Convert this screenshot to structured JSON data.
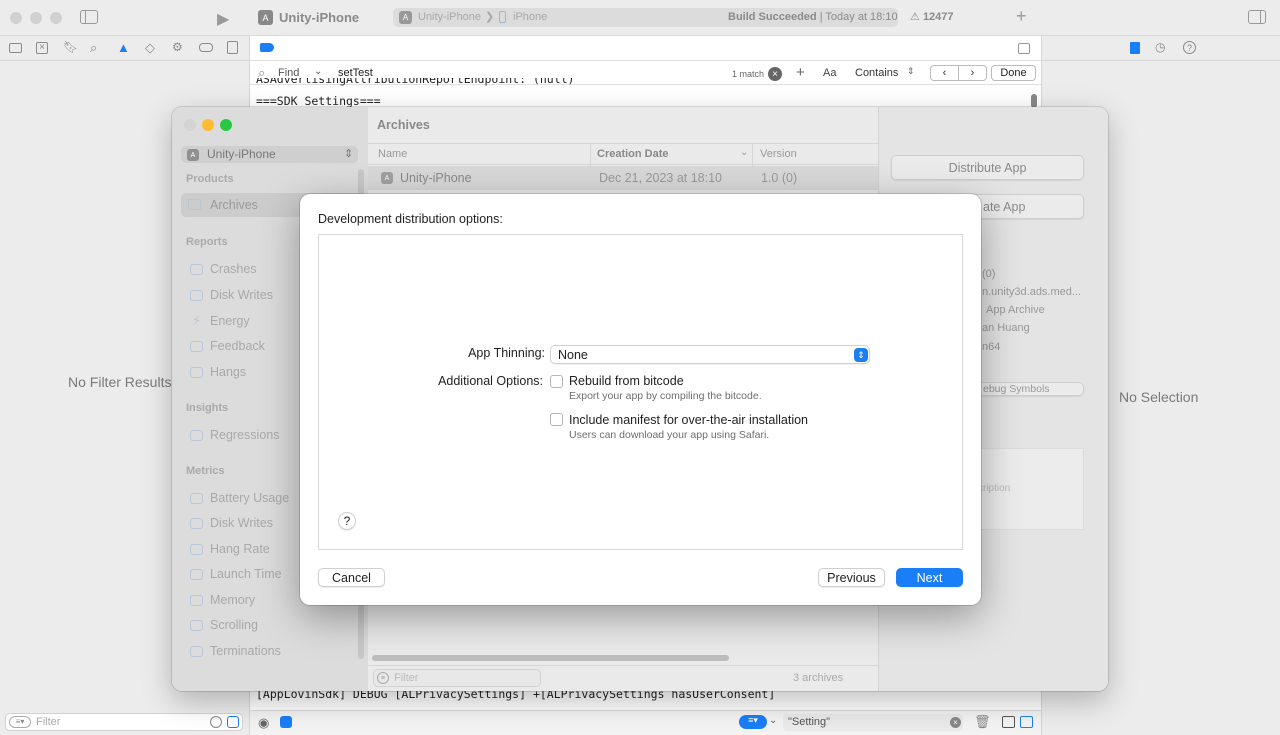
{
  "toolbar": {
    "project": "Unity-iPhone",
    "scheme": "Unity-iPhone",
    "device": "iPhone",
    "status_bold": "Build Succeeded",
    "status_time": "| Today at 18:10",
    "warnings": "12477"
  },
  "find_bar": {
    "mode": "Find",
    "query": "setTest",
    "match_count": "1 match",
    "case_label": "Aa",
    "contains_label": "Contains",
    "done_label": "Done"
  },
  "console": {
    "line_partial": "ASAdvertisingAttributionReportEndpoint: (null)",
    "line_sdk": "===SDK Settings===",
    "line_bottom": "[AppLovinSdk] DEBUG [ALPrivacySettings] +[ALPrivacySettings hasUserConsent]",
    "filter_value": "\"Setting\""
  },
  "left_panel": {
    "no_filter_text": "No Filter Results",
    "filter_placeholder": "Filter"
  },
  "right_panel": {
    "no_selection_text": "No Selection"
  },
  "organizer": {
    "scheme_selector": "Unity-iPhone",
    "sections": {
      "products": "Products",
      "reports": "Reports",
      "insights": "Insights",
      "metrics": "Metrics"
    },
    "products_items": [
      "Archives"
    ],
    "reports_items": [
      "Crashes",
      "Disk Writes",
      "Energy",
      "Feedback",
      "Hangs"
    ],
    "insights_items": [
      "Regressions"
    ],
    "metrics_items": [
      "Battery Usage",
      "Disk Writes",
      "Hang Rate",
      "Launch Time",
      "Memory",
      "Scrolling",
      "Terminations"
    ],
    "list_title": "Archives",
    "columns": {
      "name": "Name",
      "date": "Creation Date",
      "version": "Version"
    },
    "rows": [
      {
        "name": "Unity-iPhone",
        "date": "Dec 21, 2023 at 18:10",
        "version": "1.0 (0)"
      }
    ],
    "list_filter_placeholder": "Filter",
    "archive_count": "3 archives",
    "distribute_button": "Distribute App",
    "validate_button_partial": "ate App",
    "details": [
      "(0)",
      "n.unity3d.ads.med...",
      "App Archive",
      "an Huang",
      "n64"
    ],
    "debug_symbols_partial": "ebug Symbols",
    "description_partial": "cription"
  },
  "dialog": {
    "heading": "Development distribution options:",
    "thinning_label": "App Thinning:",
    "thinning_value": "None",
    "additional_label": "Additional Options:",
    "opt1_title": "Rebuild from bitcode",
    "opt1_desc": "Export your app by compiling the bitcode.",
    "opt2_title": "Include manifest for over-the-air installation",
    "opt2_desc": "Users can download your app using Safari.",
    "help_label": "?",
    "cancel_label": "Cancel",
    "previous_label": "Previous",
    "next_label": "Next"
  },
  "colors": {
    "accent": "#1a7ef7",
    "traffic_red": "#ff5f57",
    "traffic_yellow": "#febc2e",
    "traffic_green": "#28c840"
  }
}
